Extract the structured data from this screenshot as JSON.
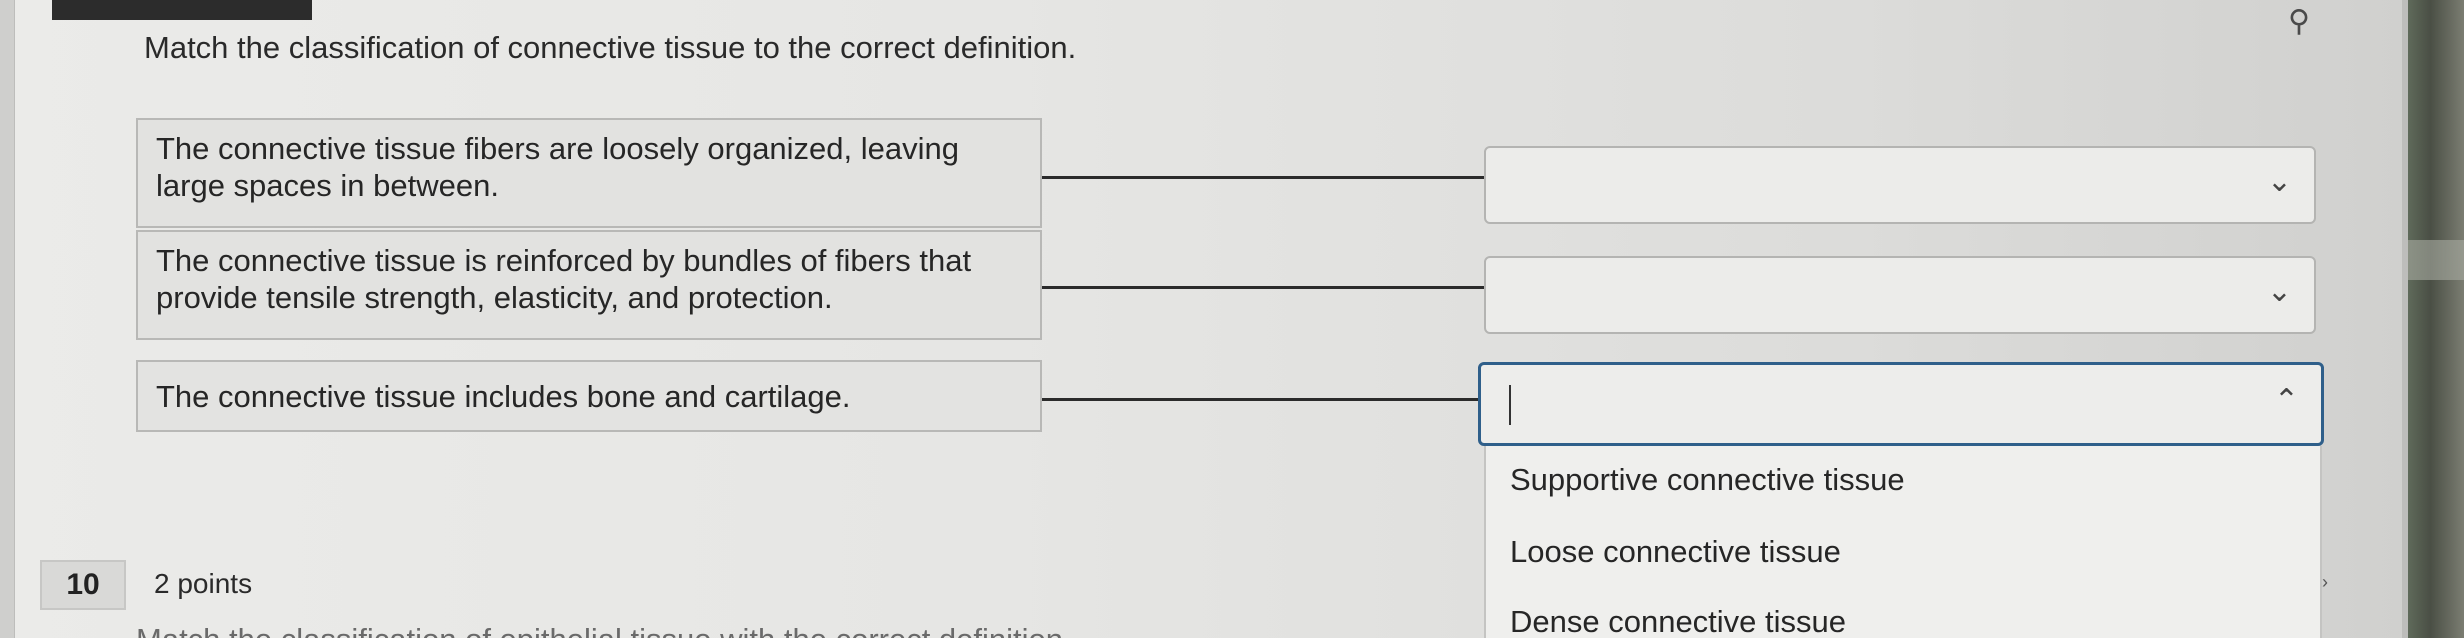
{
  "question": {
    "prompt": "Match the classification of connective tissue to the correct definition."
  },
  "definitions": [
    "The connective tissue fibers are loosely organized, leaving large spaces in between.",
    "The connective tissue is reinforced by bundles of fibers that provide tensile strength, elasticity, and protection.",
    "The connective tissue includes bone and cartilage."
  ],
  "selects": [
    {
      "value": "",
      "chevron": "chevron-down-icon"
    },
    {
      "value": "",
      "chevron": "chevron-down-icon"
    },
    {
      "value": "",
      "chevron": "chevron-up-icon",
      "open": true
    }
  ],
  "dropdown_options": [
    "Supportive connective tissue",
    "Loose connective tissue",
    "Dense connective tissue"
  ],
  "next_question": {
    "number": "10",
    "points": "2 points",
    "prompt_partial": "Match the classification of epithelial tissue with the correct definition."
  },
  "icons": {
    "pin": "pin-icon"
  }
}
